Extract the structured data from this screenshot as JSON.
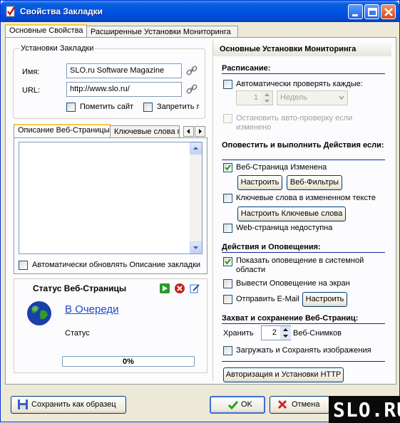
{
  "window": {
    "title": "Свойства Закладки"
  },
  "tabs": [
    {
      "label": "Основные Свойства",
      "active": true
    },
    {
      "label": "Расширенные Установки Мониторинга",
      "active": false
    }
  ],
  "bookmark_settings": {
    "legend": "Установки Закладки",
    "name_label": "Имя:",
    "name_value": "SLO.ru Software Magazine",
    "url_label": "URL:",
    "url_value": "http://www.slo.ru/",
    "mark_site_label": "Пометить сайт",
    "forbid_label": "Запретить г"
  },
  "inner_tabs": [
    {
      "label": "Описание Веб-Страницы",
      "active": true
    },
    {
      "label": "Ключевые слова п",
      "active": false
    }
  ],
  "description": {
    "auto_update_label": "Автоматически обновлять Описание закладки"
  },
  "status": {
    "title": "Статус Веб-Страницы",
    "queue_link": "В Очереди",
    "status_label": "Статус",
    "progress_text": "0%",
    "progress_value": 0
  },
  "monitoring": {
    "title": "Основные Установки Мониторинга",
    "schedule_head": "Расписание:",
    "auto_check_label": "Автоматически проверять каждые:",
    "interval_value": "1",
    "interval_unit": "Недель",
    "stop_auto_check_label": "Остановить авто-проверку если изменено",
    "notify_head": "Оповестить и выполнить Действия если:",
    "page_changed_label": "Веб-Страница Изменена",
    "configure_label": "Настроить",
    "web_filters_label": "Веб-Фильтры",
    "keywords_changed_label": "Ключевые слова в измененном тексте",
    "configure_keywords_label": "Настроить Ключевые слова",
    "page_unavailable_label": "Web-страница недоступна",
    "actions_head": "Действия и Оповещения:",
    "show_tray_label": "Показать оповещение в системной области",
    "show_screen_label": "Вывести Оповещение на экран",
    "send_email_label": "Отправить E-Mail",
    "email_configure_label": "Настроить",
    "capture_head": "Захват и сохранение Веб-Страниц:",
    "keep_label": "Хранить",
    "keep_value": "2",
    "snapshots_label": "Веб-Снимков",
    "save_images_label": "Загружать и Сохранять изображения",
    "auth_button_label": "Авторизация и Установки HTTP"
  },
  "footer": {
    "save_template_label": "Сохранить как образец",
    "ok_label": "OK",
    "cancel_label": "Отмена"
  },
  "watermark": "SLO.RU"
}
